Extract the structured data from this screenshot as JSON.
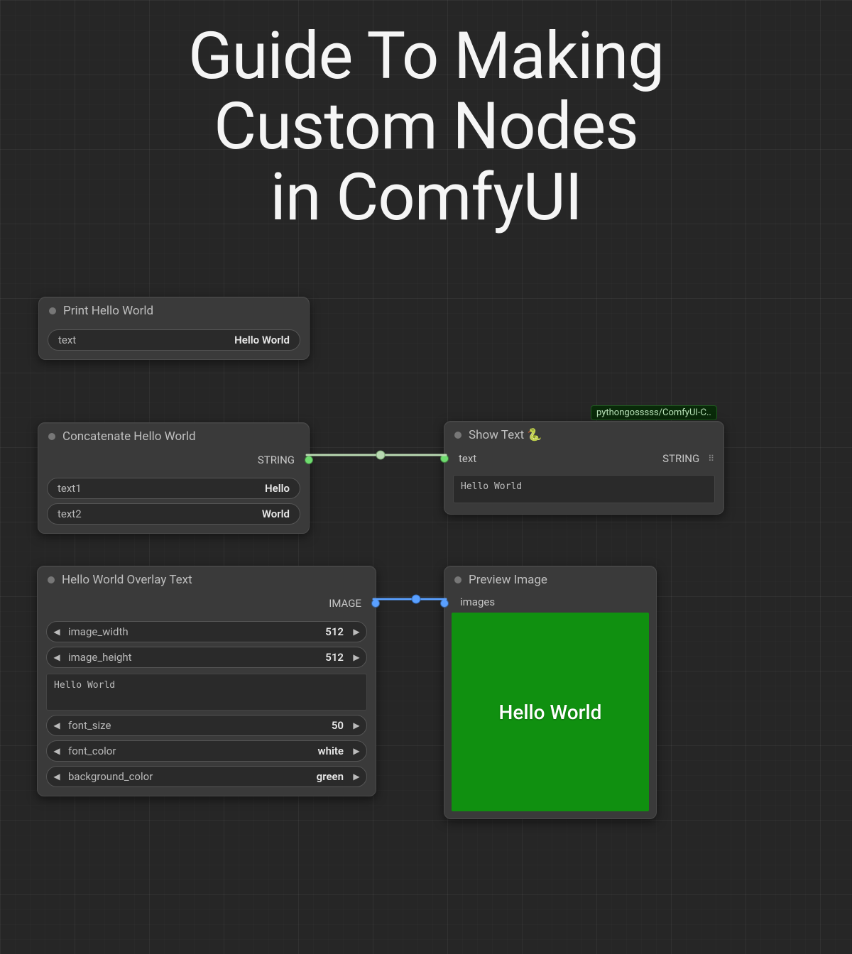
{
  "title": {
    "line1": "Guide To Making",
    "line2": "Custom Nodes",
    "line3": "in ComfyUI"
  },
  "nodes": {
    "print": {
      "title": "Print Hello World",
      "field_label": "text",
      "field_value": "Hello World"
    },
    "concat": {
      "title": "Concatenate Hello World",
      "output_label": "STRING",
      "field1_label": "text1",
      "field1_value": "Hello",
      "field2_label": "text2",
      "field2_value": "World"
    },
    "show": {
      "badge": "pythongosssss/ComfyUI-C..",
      "title": "Show Text 🐍",
      "input_label": "text",
      "output_label": "STRING",
      "content": "Hello World"
    },
    "overlay": {
      "title": "Hello World Overlay Text",
      "output_label": "IMAGE",
      "fields": {
        "image_width": {
          "label": "image_width",
          "value": "512"
        },
        "image_height": {
          "label": "image_height",
          "value": "512"
        },
        "text": "Hello World",
        "font_size": {
          "label": "font_size",
          "value": "50"
        },
        "font_color": {
          "label": "font_color",
          "value": "white"
        },
        "background_color": {
          "label": "background_color",
          "value": "green"
        }
      }
    },
    "preview": {
      "title": "Preview Image",
      "input_label": "images",
      "image_text": "Hello World",
      "image_bg": "#109010",
      "image_fg": "#ffffff"
    }
  }
}
